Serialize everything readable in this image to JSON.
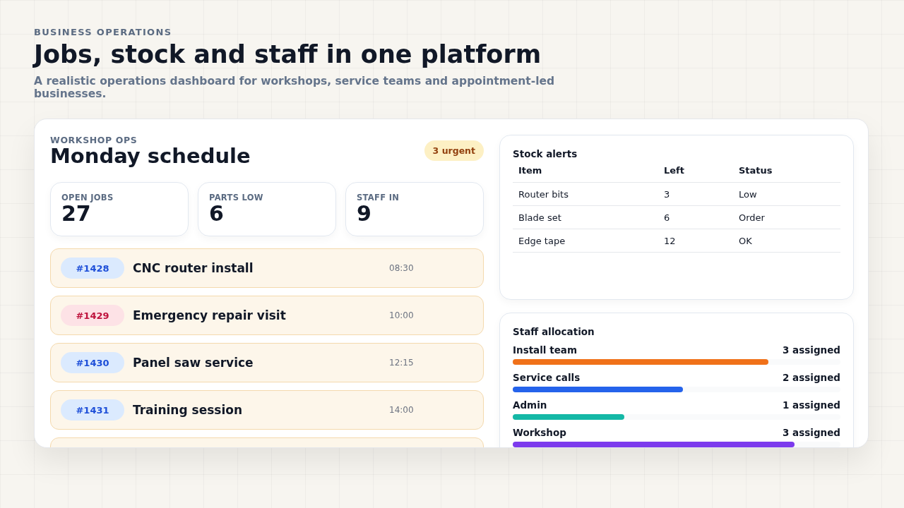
{
  "header": {
    "eyebrow": "BUSINESS OPERATIONS",
    "title": "Jobs, stock and staff in one platform",
    "subtitle": "A realistic operations dashboard for workshops, service teams and appointment-led businesses."
  },
  "schedule": {
    "eyebrow": "WORKSHOP OPS",
    "title": "Monday schedule",
    "badge": "3 urgent",
    "stats": [
      {
        "label": "OPEN JOBS",
        "value": "27"
      },
      {
        "label": "PARTS LOW",
        "value": "6"
      },
      {
        "label": "STAFF IN",
        "value": "9"
      }
    ],
    "jobs": [
      {
        "id": "#1428",
        "title": "CNC router install",
        "time": "08:30",
        "urgent": false
      },
      {
        "id": "#1429",
        "title": "Emergency repair visit",
        "time": "10:00",
        "urgent": true
      },
      {
        "id": "#1430",
        "title": "Panel saw service",
        "time": "12:15",
        "urgent": false
      },
      {
        "id": "#1431",
        "title": "Training session",
        "time": "14:00",
        "urgent": false
      }
    ]
  },
  "stock_alerts": {
    "title": "Stock alerts",
    "columns": [
      "Item",
      "Left",
      "Status"
    ],
    "rows": [
      [
        "Router bits",
        "3",
        "Low"
      ],
      [
        "Blade set",
        "6",
        "Order"
      ],
      [
        "Edge tape",
        "12",
        "OK"
      ]
    ]
  },
  "staff_allocation": {
    "title": "Staff allocation",
    "teams": [
      {
        "name": "Install team",
        "reading": "3 assigned",
        "level": 0.78,
        "color": "#f07119"
      },
      {
        "name": "Service calls",
        "reading": "2 assigned",
        "level": 0.52,
        "color": "#2563eb"
      },
      {
        "name": "Admin",
        "reading": "1 assigned",
        "level": 0.34,
        "color": "#14b8a6"
      },
      {
        "name": "Workshop",
        "reading": "3 assigned",
        "level": 0.86,
        "color": "#7c3aed"
      }
    ]
  }
}
